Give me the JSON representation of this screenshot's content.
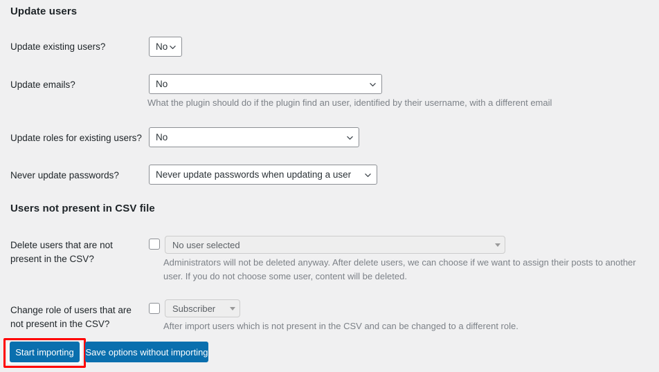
{
  "sections": {
    "update_users": {
      "heading": "Update users",
      "fields": [
        {
          "label": "Update existing users?",
          "value": "No"
        },
        {
          "label": "Update emails?",
          "value": "No",
          "help": "What the plugin should do if the plugin find an user, identified by their username, with a different email"
        },
        {
          "label": "Update roles for existing users?",
          "value": "No"
        },
        {
          "label": "Never update passwords?",
          "value": "Never update passwords when updating a user"
        }
      ]
    },
    "users_not_present": {
      "heading": "Users not present in CSV file",
      "fields": [
        {
          "label_line1": "Delete users that are not",
          "label_line2": "present in the CSV?",
          "value": "No user selected",
          "help_line1": "Administrators will not be deleted anyway. After delete users, we can choose if we want to assign their posts to another",
          "help_line2": "user. If you do not choose some user, content will be deleted."
        },
        {
          "label_line1": "Change role of users that are",
          "label_line2": "not present in the CSV?",
          "value": "Subscriber",
          "help_line1": "After import users which is not present in the CSV and can be changed to a different role."
        }
      ]
    }
  },
  "actions": {
    "start_importing": "Start importing",
    "save_options": "Save options without importing"
  },
  "colors": {
    "background": "#f0f0f1",
    "button_primary": "#0a6fae",
    "focus_ring": "#ff0000",
    "text": "#1d2327",
    "help_text": "#7c8187"
  },
  "icons": {
    "chevron_down": "chevron-down-icon",
    "caret_down": "caret-down-icon"
  }
}
